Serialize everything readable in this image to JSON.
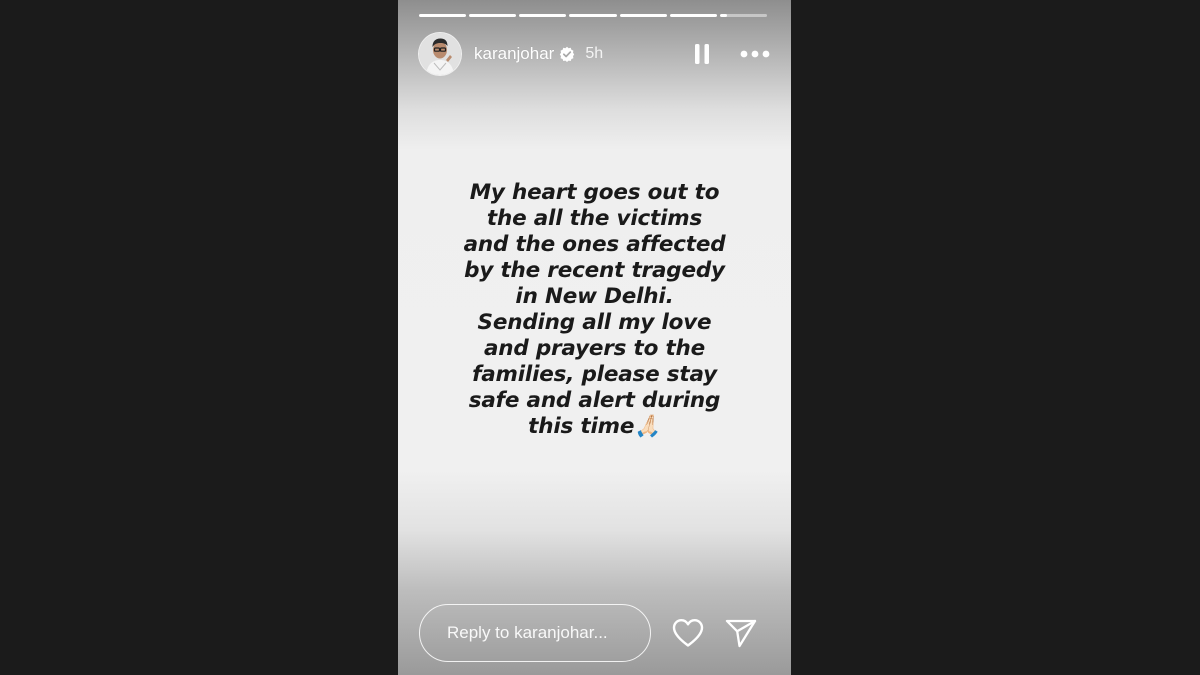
{
  "story": {
    "segment_count": 7,
    "current_segment_index": 6,
    "current_segment_progress": 0.15,
    "header": {
      "username": "karanjohar",
      "verified": true,
      "timestamp": "5h",
      "avatar_icon": "profile-photo",
      "pause_icon": "pause-icon",
      "more_icon": "more-options-icon"
    },
    "message": "My heart goes out to\nthe all the victims\nand the ones affected\nby the recent tragedy\nin New Delhi.\nSending all my love\nand prayers to the\nfamilies, please stay\nsafe and alert during\nthis time🙏🏻",
    "footer": {
      "reply_placeholder": "Reply to karanjohar...",
      "like_icon": "heart-icon",
      "share_icon": "send-icon"
    }
  },
  "colors": {
    "page_background": "#1b1b1b",
    "story_text": "#1a1a1a",
    "ui_foreground": "#ffffff",
    "verified_badge": "#ffffff"
  }
}
